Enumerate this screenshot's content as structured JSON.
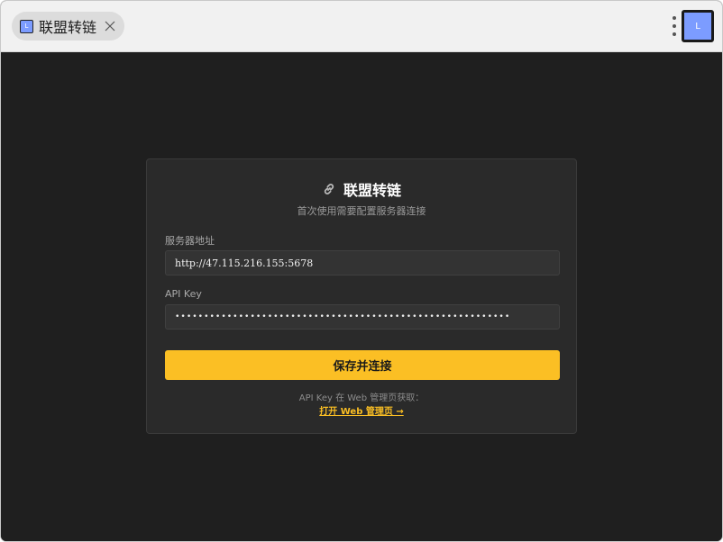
{
  "tab": {
    "title": "联盟转链",
    "favicon_letter": "L"
  },
  "toolbar": {
    "extension_letter": "L"
  },
  "card": {
    "title": "联盟转链",
    "subtitle": "首次使用需要配置服务器连接",
    "server_label": "服务器地址",
    "server_value": "http://47.115.216.155:5678",
    "apikey_label": "API Key",
    "apikey_value": "••••••••••••••••••••••••••••••••••••••••••••••••••••••••••",
    "save_button": "保存并连接",
    "hint_text": "API Key 在 Web 管理页获取：",
    "open_link": "打开 Web 管理页 →"
  },
  "colors": {
    "accent": "#fbbf24",
    "background": "#1f1f1f",
    "card": "#2a2a2a",
    "field": "#333333",
    "favicon": "#7c9cff"
  },
  "icons": [
    "link-icon",
    "close-icon",
    "more-vert-icon",
    "extension-icon"
  ]
}
